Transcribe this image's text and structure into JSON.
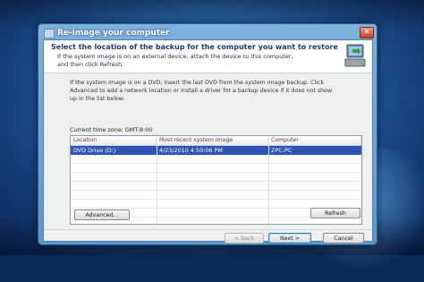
{
  "window": {
    "title": "Re-image your computer"
  },
  "header": {
    "main": "Select the location of the backup for the computer you want to restore",
    "sub_line1": "If the system image is on an external device, attach the device to this computer,",
    "sub_line2": "and then click Refresh."
  },
  "description": {
    "line1": "If the system image is on a DVD, insert the last DVD from the system image backup. Click",
    "line2": "Advanced to add a network location or install a driver for a backup device if it does not show",
    "line3": "up in the list below."
  },
  "timezone": "Current time zone: GMT-8:00",
  "table": {
    "columns": [
      "Location",
      "Most recent system image",
      "Computer"
    ],
    "rows": [
      {
        "location": "DVD Drive (D:)",
        "image": "4/23/2010 4:50:06 PM",
        "computer": "ZPC-PC"
      }
    ]
  },
  "buttons": {
    "advanced": "Advanced...",
    "refresh": "Refresh",
    "back": "< Back",
    "next": "Next >",
    "cancel": "Cancel"
  },
  "colors": {
    "selection": "#2f54b4",
    "title_text": "#1e3a6e"
  }
}
